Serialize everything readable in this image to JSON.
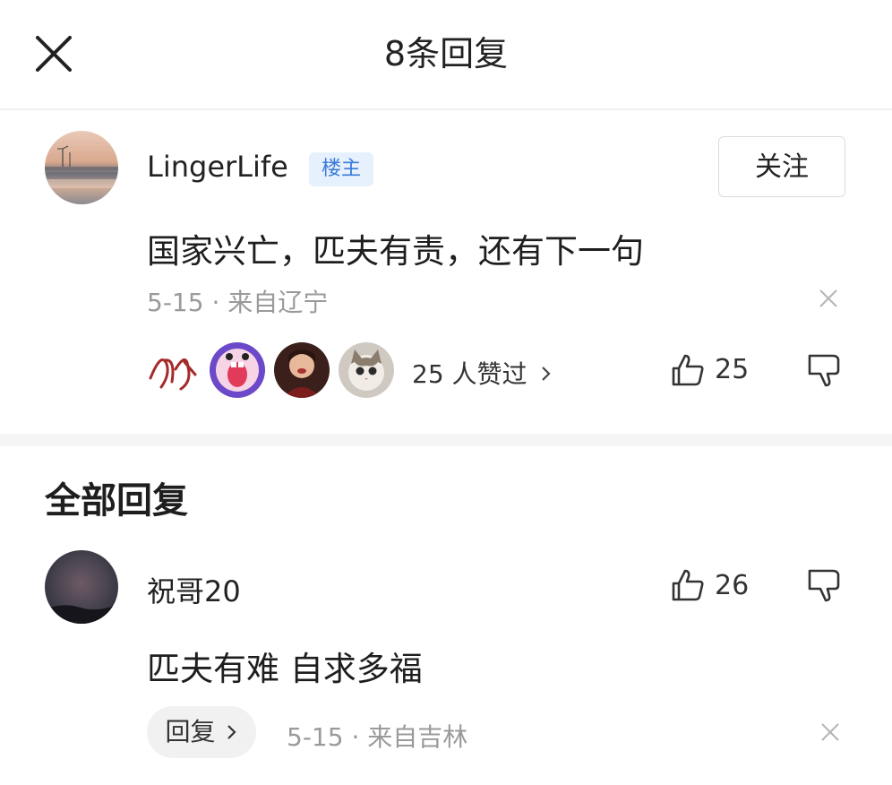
{
  "header": {
    "title": "8条回复"
  },
  "post": {
    "username": "LingerLife",
    "badge": "楼主",
    "follow_label": "关注",
    "content": "国家兴亡，匹夫有责，还有下一句",
    "date": "5-15",
    "location": "来自辽宁",
    "likers_text": "25 人赞过",
    "like_count": "25"
  },
  "section": {
    "title": "全部回复"
  },
  "reply": {
    "username": "祝哥20",
    "like_count": "26",
    "content": "匹夫有难 自求多福",
    "reply_label": "回复",
    "date": "5-15",
    "location": "来自吉林"
  },
  "colors": {
    "badge_bg": "#e6f1fd",
    "badge_text": "#3a7ad8",
    "meta": "#9a9a9a"
  },
  "icons": [
    "close-icon",
    "dismiss-icon",
    "thumbs-up-icon",
    "thumbs-down-icon",
    "chevron-right-icon"
  ]
}
